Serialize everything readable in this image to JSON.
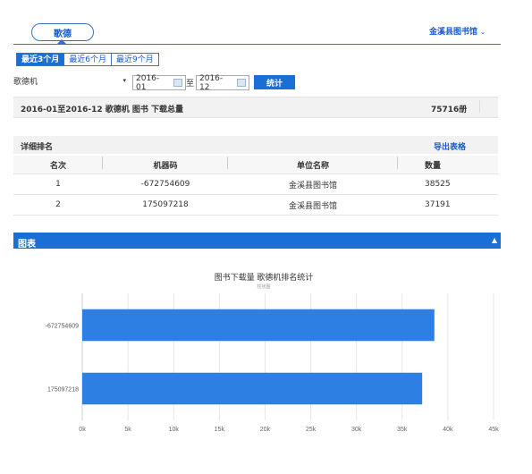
{
  "header": {
    "tab_label": "歌德",
    "library_menu": "金溪县图书馆"
  },
  "range_tabs": [
    "最近3个月",
    "最近6个月",
    "最近9个月"
  ],
  "filters": {
    "machine": "歌德机",
    "start_date": "2016-01",
    "to": "至",
    "end_date": "2016-12",
    "submit": "统计"
  },
  "summary": {
    "text": "2016-01至2016-12 歌德机 图书 下载总量",
    "total": "75716册"
  },
  "ranking": {
    "title": "详细排名",
    "export": "导出表格",
    "columns": [
      "名次",
      "机器码",
      "单位名称",
      "数量"
    ],
    "rows": [
      [
        "1",
        "-672754609",
        "金溪县图书馆",
        "38525"
      ],
      [
        "2",
        "175097218",
        "金溪县图书馆",
        "37191"
      ]
    ]
  },
  "chart_panel": {
    "title": "图表",
    "collapse_icon": "triangle-up-icon"
  },
  "chart_data": {
    "type": "bar",
    "orientation": "horizontal",
    "title": "图书下载量 歌德机排名统计",
    "subtitle": "柱状图",
    "categories": [
      "-672754609",
      "175097218"
    ],
    "values": [
      38525,
      37191
    ],
    "xlim": [
      0,
      45000
    ],
    "x_ticks": [
      "0k",
      "5k",
      "10k",
      "15k",
      "20k",
      "25k",
      "30k",
      "35k",
      "40k",
      "45k"
    ],
    "color": "#2e7fe3",
    "grid": true
  }
}
